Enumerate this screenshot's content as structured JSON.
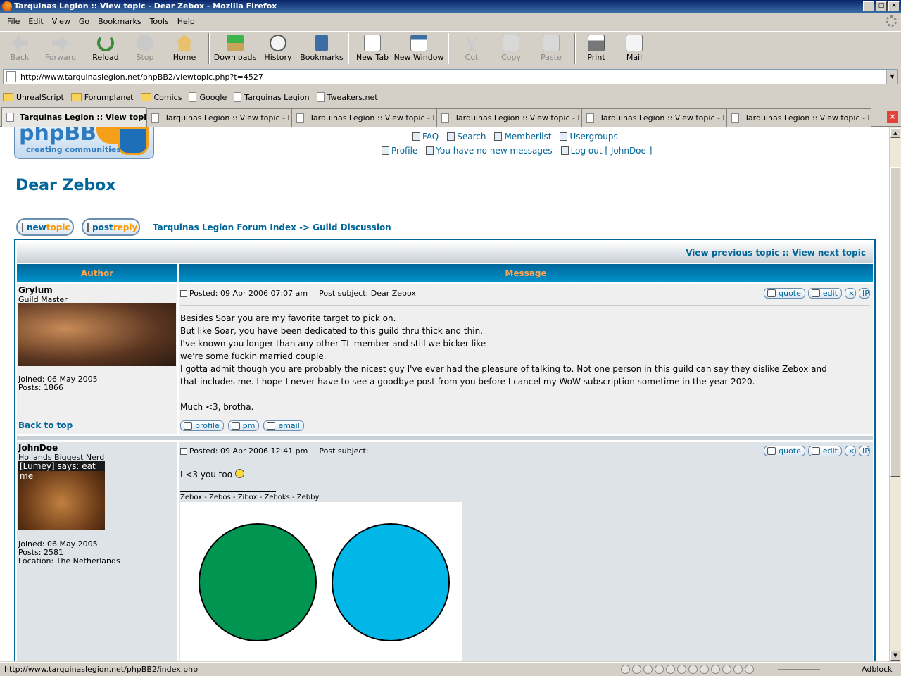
{
  "window": {
    "title": "Tarquinas Legion :: View topic - Dear Zebox - Mozilla Firefox"
  },
  "menu": [
    "File",
    "Edit",
    "View",
    "Go",
    "Bookmarks",
    "Tools",
    "Help"
  ],
  "toolbar": {
    "back": "Back",
    "forward": "Forward",
    "reload": "Reload",
    "stop": "Stop",
    "home": "Home",
    "downloads": "Downloads",
    "history": "History",
    "bookmarks": "Bookmarks",
    "new_tab": "New Tab",
    "new_window": "New Window",
    "cut": "Cut",
    "copy": "Copy",
    "paste": "Paste",
    "print": "Print",
    "mail": "Mail"
  },
  "address": {
    "url": "http://www.tarquinaslegion.net/phpBB2/viewtopic.php?t=4527"
  },
  "bookmarks": [
    {
      "label": "UnrealScript",
      "type": "folder"
    },
    {
      "label": "Forumplanet",
      "type": "folder"
    },
    {
      "label": "Comics",
      "type": "folder"
    },
    {
      "label": "Google",
      "type": "page"
    },
    {
      "label": "Tarquinas Legion",
      "type": "page"
    },
    {
      "label": "Tweakers.net",
      "type": "page"
    }
  ],
  "tabs": [
    "Tarquinas Legion :: View topic...",
    "Tarquinas Legion :: View topic - D...",
    "Tarquinas Legion :: View topic - D...",
    "Tarquinas Legion :: View topic - D...",
    "Tarquinas Legion :: View topic - D...",
    "Tarquinas Legion :: View topic - D..."
  ],
  "site": {
    "logo_big": "phpBB",
    "logo_small": "creating communities",
    "nav": {
      "faq": "FAQ",
      "search": "Search",
      "memberlist": "Memberlist",
      "usergroups": "Usergroups",
      "profile": "Profile",
      "messages": "You have no new messages",
      "logout": "Log out [ JohnDoe ]"
    },
    "topic_title": "Dear Zebox",
    "buttons": {
      "new_a": "new",
      "new_b": "topic",
      "reply_a": "post",
      "reply_b": "reply"
    },
    "crumb": "Tarquinas Legion Forum Index -> Guild Discussion",
    "topic_nav": "View previous topic :: View next topic",
    "headers": {
      "author": "Author",
      "message": "Message"
    },
    "back_to_top": "Back to top"
  },
  "posts": [
    {
      "author": "Grylum",
      "rank": "Guild Master",
      "joined": "Joined: 06 May 2005",
      "posts": "Posts: 1866",
      "posted": "Posted: 09 Apr 2006 07:07 am",
      "subject": "Post subject: Dear Zebox",
      "lines": [
        "Besides Soar you are my favorite target to pick on.",
        "But like Soar, you have been dedicated to this guild thru thick and thin.",
        "I've known you longer than any other TL member and still we bicker like",
        "we're some fuckin married couple.",
        "I gotta admit though you are probably the nicest guy I've ever had the pleasure of talking to. Not one person in this guild can say they dislike Zebox and",
        "that includes me. I hope I never have to see a goodbye post from you before I cancel my WoW subscription sometime in the year 2020.",
        "",
        "Much <3, brotha."
      ],
      "actions": {
        "quote": "quote",
        "edit": "edit",
        "profile": "profile",
        "pm": "pm",
        "email": "email"
      }
    },
    {
      "author": "JohnDoe",
      "rank": "Hollands Biggest Nerd",
      "avatar_caption": "[Lumey] says: eat me",
      "joined": "Joined: 06 May 2005",
      "posts": "Posts: 2581",
      "location": "Location: The Netherlands",
      "posted": "Posted: 09 Apr 2006 12:41 pm",
      "subject": "Post subject:",
      "body": "I <3 you too",
      "signature": "Zebox - Zebos - Zibox - Zeboks - Zebby",
      "sig_colors": {
        "left": "#009550",
        "right": "#00b7e8"
      },
      "actions": {
        "quote": "quote",
        "edit": "edit"
      }
    }
  ],
  "status": {
    "url": "http://www.tarquinaslegion.net/phpBB2/index.php",
    "adblock": "Adblock"
  }
}
